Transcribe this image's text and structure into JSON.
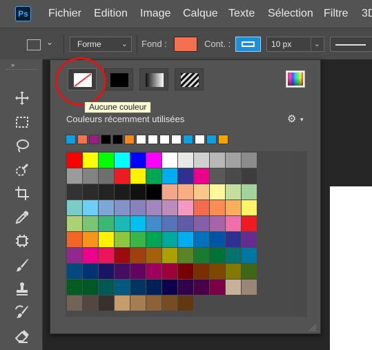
{
  "app": {
    "logo_text": "Ps"
  },
  "menu": [
    "Fichier",
    "Edition",
    "Image",
    "Calque",
    "Texte",
    "Sélection",
    "Filtre",
    "3D"
  ],
  "options": {
    "mode_value": "Forme",
    "fill_label": "Fond :",
    "fill_color": "#f5704e",
    "stroke_label": "Cont. :",
    "stroke_color": "#1e8fd6",
    "stroke_width_value": "10 px"
  },
  "toolbar": {
    "collapse_icon": "»",
    "tools": [
      "move-icon",
      "marquee-icon",
      "lasso-icon",
      "quick-select-icon",
      "crop-icon",
      "eyedropper-icon",
      "frame-icon",
      "brush-icon",
      "stamp-icon",
      "history-brush-icon",
      "eraser-icon"
    ]
  },
  "picker": {
    "fill_types": [
      "Aucune couleur",
      "Couleur unie",
      "Dégradé",
      "Motif"
    ],
    "tooltip_text": "Aucune couleur",
    "recent_label": "Couleurs récemment utilisées",
    "settings_icon": "gear-icon",
    "recent_colors": [
      "#0ea0df",
      "#f5704e",
      "#9b1c83",
      "#000000",
      "#000000",
      "#f4871f",
      "#ffffff",
      "#ffffff",
      "#ffffff",
      "#ffffff",
      "#0ea0df",
      "#ffffff",
      "#0ea0df",
      "#f5a300"
    ],
    "swatch_rows": [
      [
        "#ff0000",
        "#ffff00",
        "#00ff00",
        "#00ffff",
        "#0000ff",
        "#ff00ff",
        "#ffffff",
        "#e8e8e8",
        "#d1d1d1",
        "#b8b8b8",
        "#a2a2a2",
        "#8c8c8c"
      ],
      [
        "#9b9b9b",
        "#838383",
        "#6f6f6f",
        "#ed1c24",
        "#fff200",
        "#00a651",
        "#00aeef",
        "#2e3192",
        "#ec008c",
        "#595959",
        "#4a4a4a",
        "#3d3d3d"
      ],
      [
        "#333333",
        "#2b2b2b",
        "#232323",
        "#1c1c1c",
        "#111111",
        "#000000",
        "#f4a68c",
        "#f9ad81",
        "#fdc68a",
        "#fff799",
        "#c4df9b",
        "#a3d39c"
      ],
      [
        "#7accc8",
        "#6dcff6",
        "#7da7d8",
        "#8393ca",
        "#8781bd",
        "#a187be",
        "#bd8cbf",
        "#f49ac2",
        "#f26c4f",
        "#f68e55",
        "#fbaf5c",
        "#fff467"
      ],
      [
        "#acd372",
        "#7cc576",
        "#3bb878",
        "#1abbb4",
        "#00bff3",
        "#438ccb",
        "#5574b9",
        "#605ca8",
        "#8560a8",
        "#a864a8",
        "#f06ea9",
        "#ed1c24"
      ],
      [
        "#f26522",
        "#f7941d",
        "#fff200",
        "#8dc63f",
        "#39b54a",
        "#00a651",
        "#00a99d",
        "#00aeef",
        "#0072bc",
        "#0054a6",
        "#2e3192",
        "#662d91"
      ],
      [
        "#92278f",
        "#ec008c",
        "#ed145b",
        "#9e0b0f",
        "#a0410d",
        "#a36209",
        "#aba000",
        "#598527",
        "#197b30",
        "#007236",
        "#00746b",
        "#0076a3"
      ],
      [
        "#004a80",
        "#003471",
        "#1b1464",
        "#440e62",
        "#630460",
        "#9e005d",
        "#9e0039",
        "#790000",
        "#7b2e00",
        "#7d4900",
        "#827b00",
        "#406618"
      ],
      [
        "#005e20",
        "#005826",
        "#005952",
        "#005b7f",
        "#003663",
        "#002157",
        "#0d004c",
        "#32004b",
        "#4b0049",
        "#7b0046",
        "#c7b299",
        "#998675"
      ],
      [
        "#736357",
        "#534741",
        "#37302d",
        "#c69c6d",
        "#a67c52",
        "#8c6239",
        "#754c24",
        "#603913"
      ]
    ]
  }
}
